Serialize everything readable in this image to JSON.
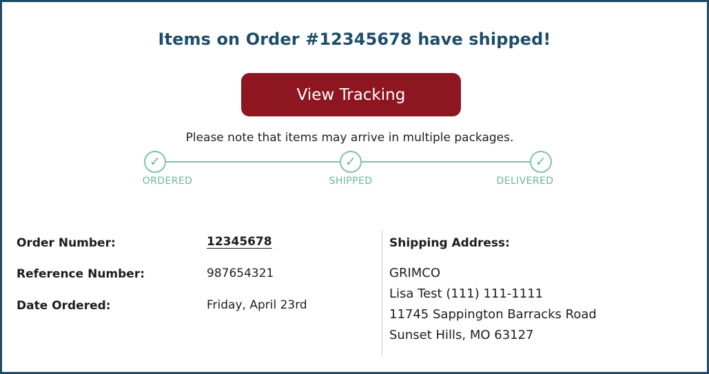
{
  "header": {
    "title": "Items on Order #12345678 have shipped!"
  },
  "actions": {
    "view_tracking_label": "View Tracking"
  },
  "notice": {
    "text": "Please note that items may arrive in multiple packages."
  },
  "progress": {
    "steps": [
      {
        "label": "ORDERED",
        "icon": "check-icon",
        "status": "complete"
      },
      {
        "label": "SHIPPED",
        "icon": "check-icon",
        "status": "complete"
      },
      {
        "label": "DELIVERED",
        "icon": "check-icon",
        "status": "complete"
      }
    ],
    "check_glyph": "✓"
  },
  "order_details": {
    "order_number_label": "Order Number:",
    "order_number_value": "12345678",
    "reference_number_label": "Reference Number:",
    "reference_number_value": "987654321",
    "date_ordered_label": "Date Ordered:",
    "date_ordered_value": "Friday, April 23rd"
  },
  "shipping": {
    "title": "Shipping Address:",
    "lines": [
      "GRIMCO",
      "Lisa Test (111) 111-1111",
      "11745 Sappington Barracks Road",
      "Sunset Hills, MO 63127"
    ]
  },
  "colors": {
    "border": "#1f4a66",
    "headline": "#1d4d69",
    "button_bg": "#8e1620",
    "progress_green": "#7fc2a4"
  }
}
